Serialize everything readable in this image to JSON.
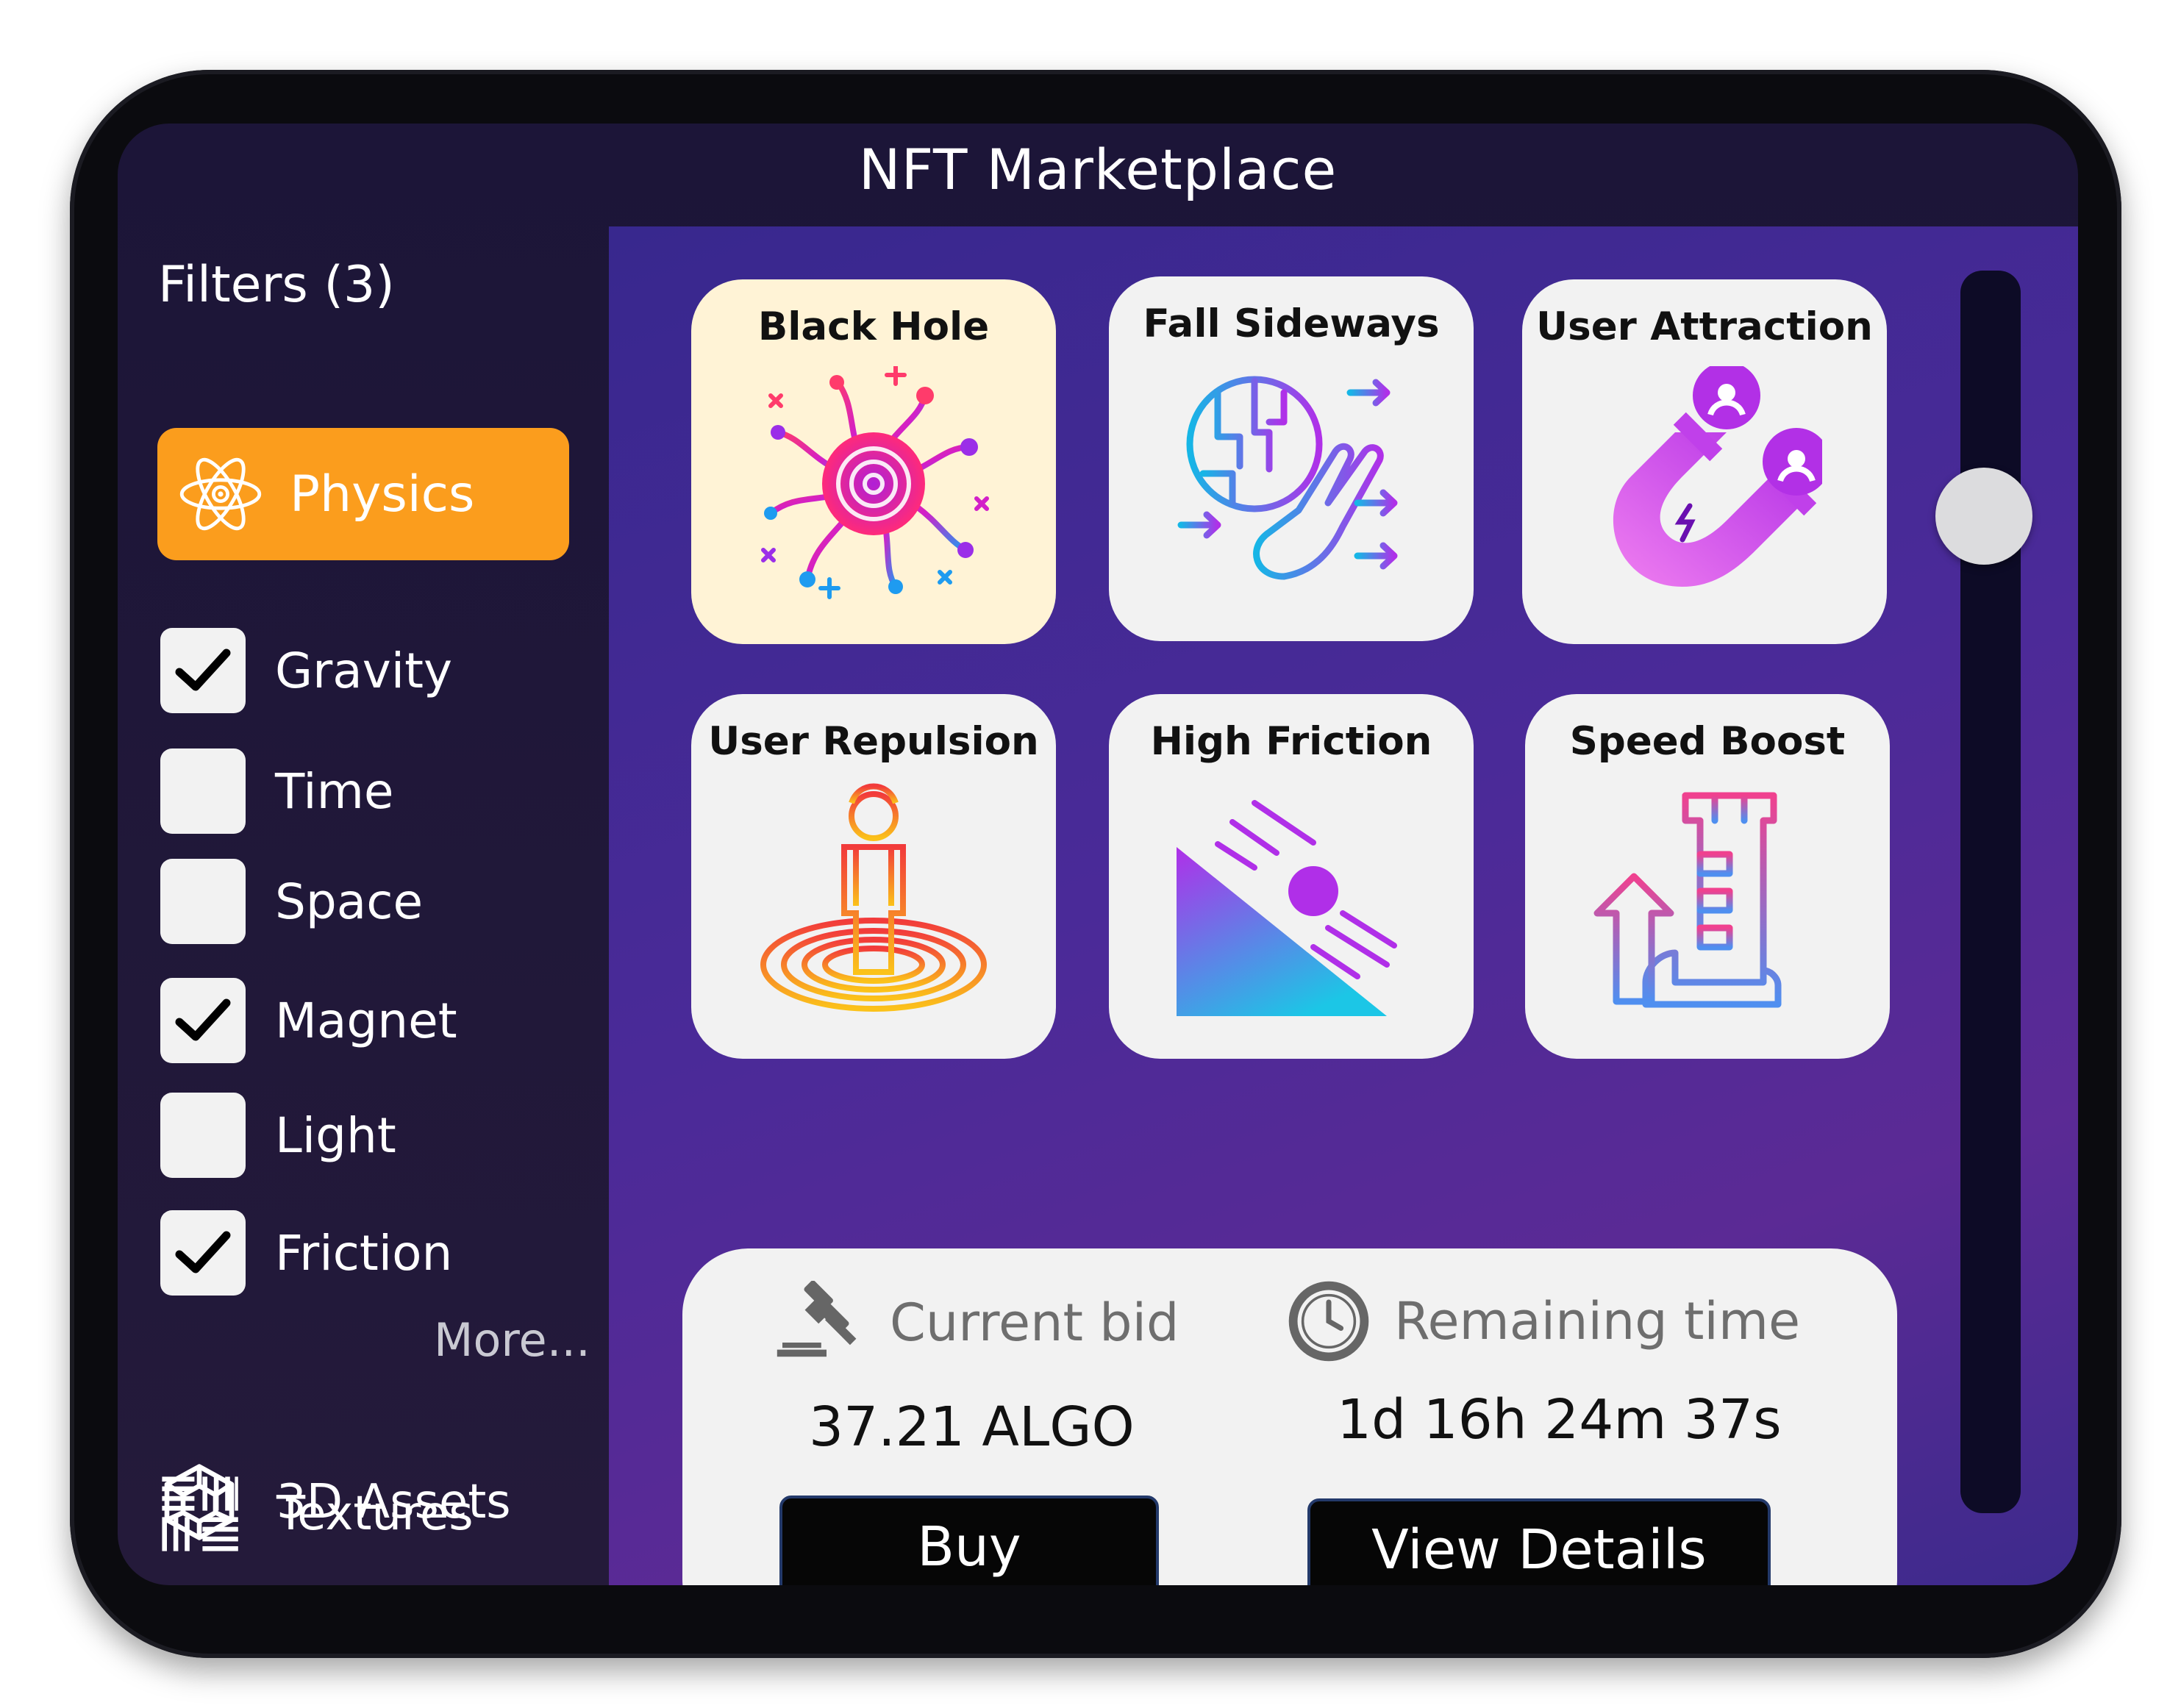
{
  "app": {
    "title": "NFT Marketplace"
  },
  "sidebar": {
    "filters_title": "Filters (3)",
    "active_category": {
      "label": "Physics",
      "icon": "atom-icon",
      "color": "#fb9d1d"
    },
    "filters": [
      {
        "label": "Gravity",
        "checked": true
      },
      {
        "label": "Time",
        "checked": false
      },
      {
        "label": "Space",
        "checked": false
      },
      {
        "label": "Magnet",
        "checked": true
      },
      {
        "label": "Light",
        "checked": false
      },
      {
        "label": "Friction",
        "checked": true
      }
    ],
    "more_label": "More...",
    "nav": [
      {
        "label": "3D Assets",
        "icon": "cube-icon"
      },
      {
        "label": "Textures",
        "icon": "texture-grid-icon"
      }
    ]
  },
  "cards": [
    {
      "title": "Black Hole",
      "icon": "black-hole-icon",
      "selected": true
    },
    {
      "title": "Fall Sideways",
      "icon": "globe-hand-icon",
      "selected": false
    },
    {
      "title": "User Attraction",
      "icon": "magnet-icon",
      "selected": false
    },
    {
      "title": "User Repulsion",
      "icon": "person-rings-icon",
      "selected": false
    },
    {
      "title": "High Friction",
      "icon": "slope-ball-icon",
      "selected": false
    },
    {
      "title": "Speed Boost",
      "icon": "boot-arrow-icon",
      "selected": false
    }
  ],
  "auction": {
    "bid_label": "Current bid",
    "bid_value": "37.21 ALGO",
    "time_label": "Remaining time",
    "time_value": "1d 16h 24m 37s",
    "buy_label": "Buy",
    "details_label": "View Details"
  },
  "colors": {
    "accent": "#fb9d1d",
    "panel_bg": "#f2f2f2",
    "selected_card": "#fff3d6"
  }
}
